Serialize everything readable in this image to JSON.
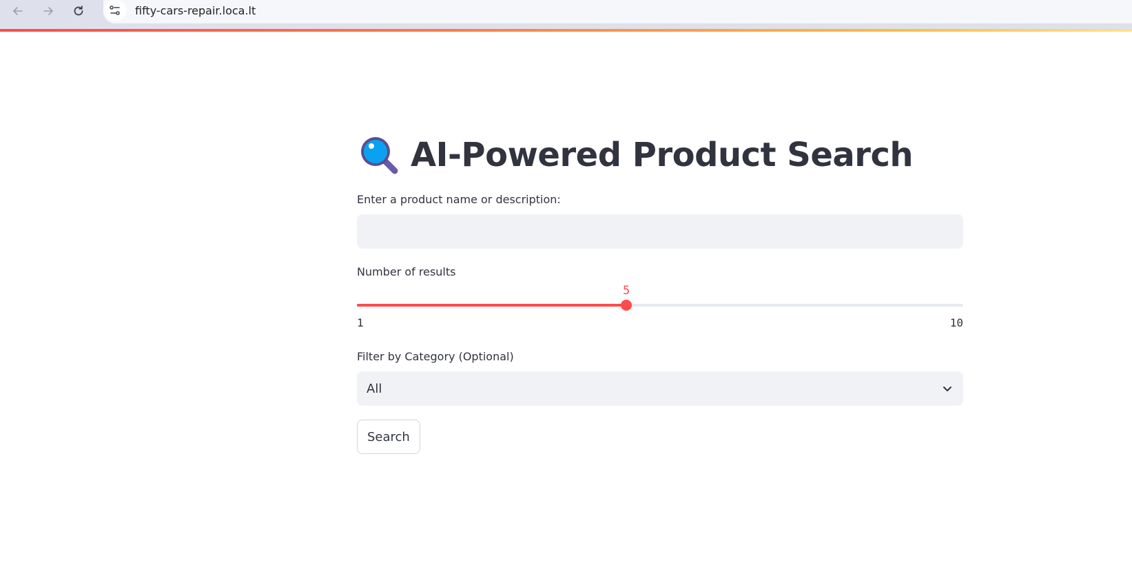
{
  "browser": {
    "url": "fifty-cars-repair.loca.lt",
    "back_icon": "arrow-left-icon",
    "forward_icon": "arrow-right-icon",
    "reload_icon": "reload-icon",
    "site_info_icon": "tune-icon"
  },
  "app": {
    "title": "AI-Powered Product Search",
    "title_icon": "magnifying-glass-icon"
  },
  "form": {
    "query_label": "Enter a product name or description:",
    "query_value": "",
    "results_label": "Number of results",
    "results_slider": {
      "min": 1,
      "max": 10,
      "value": 5,
      "min_label": "1",
      "max_label": "10",
      "value_label": "5"
    },
    "category_label": "Filter by Category (Optional)",
    "category_selected": "All",
    "search_label": "Search"
  },
  "colors": {
    "accent": "#ff4b4b",
    "text": "#31333f",
    "input_bg": "#f0f2f6"
  }
}
